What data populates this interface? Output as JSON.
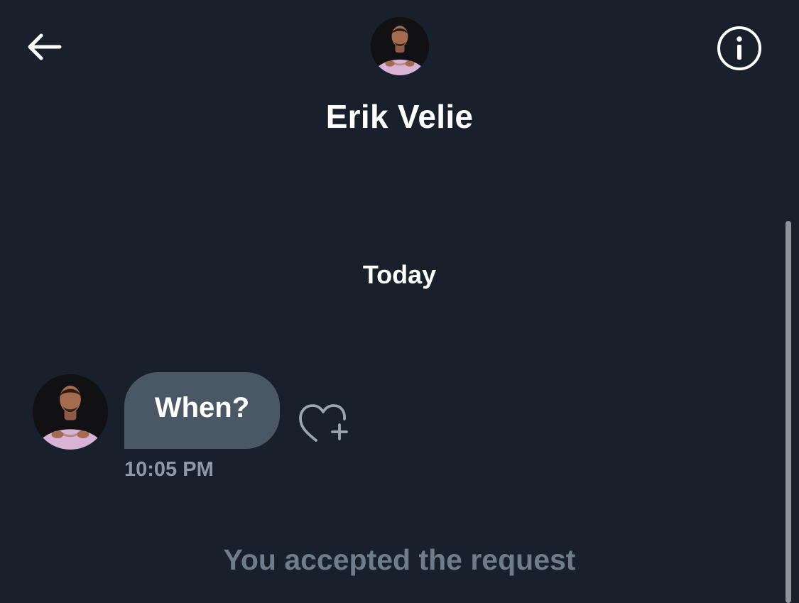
{
  "header": {
    "back_icon": "arrow-left-icon",
    "info_icon": "info-circle-icon",
    "contact_name": "Erik Velie",
    "avatar_icon": "profile-photo"
  },
  "conversation": {
    "date_divider": "Today",
    "messages": [
      {
        "text": "When?",
        "time": "10:05 PM",
        "reaction_icon": "heart-plus-icon"
      }
    ],
    "system_message": "You accepted the request"
  },
  "colors": {
    "background": "#18202b",
    "bubble": "#4a5866",
    "primary_text": "#ffffff",
    "secondary_text": "#8d99a6",
    "system_text": "#6f7c89"
  }
}
